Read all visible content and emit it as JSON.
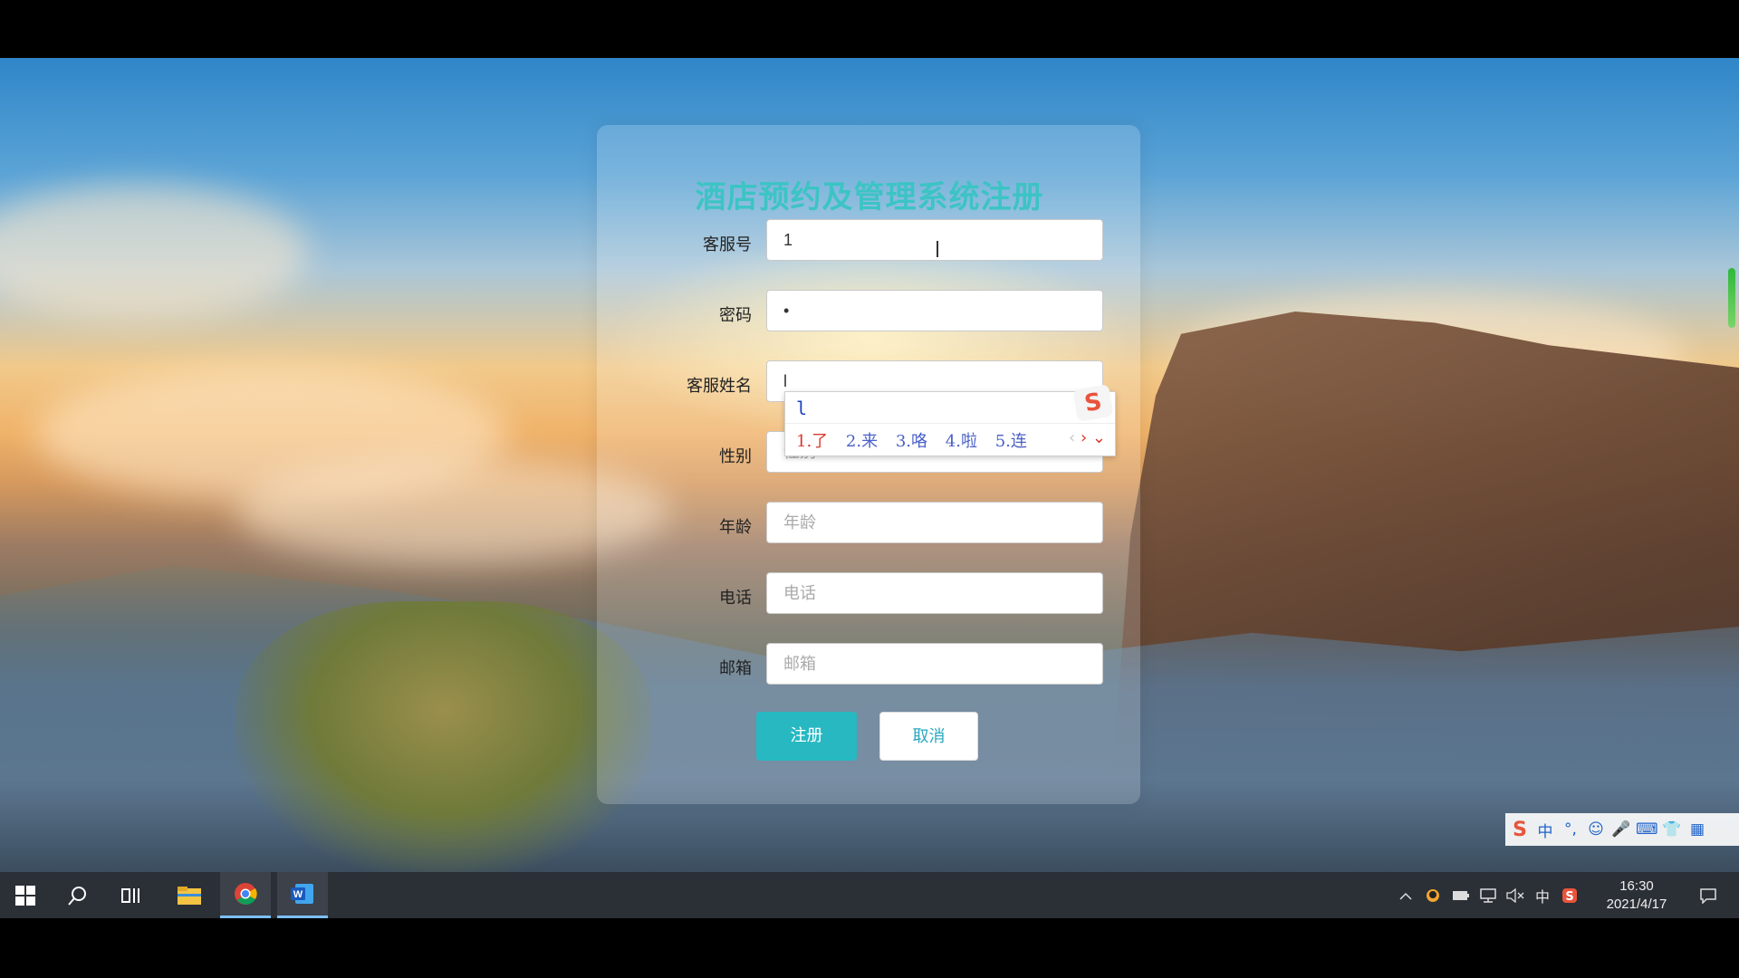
{
  "form": {
    "title": "酒店预约及管理系统注册",
    "fields": [
      {
        "label": "客服号",
        "value": "1",
        "placeholder": ""
      },
      {
        "label": "密码",
        "value": "•",
        "placeholder": ""
      },
      {
        "label": "客服姓名",
        "value": "l",
        "placeholder": ""
      },
      {
        "label": "性别",
        "value": "",
        "placeholder": "性别"
      },
      {
        "label": "年龄",
        "value": "",
        "placeholder": "年龄"
      },
      {
        "label": "电话",
        "value": "",
        "placeholder": "电话"
      },
      {
        "label": "邮箱",
        "value": "",
        "placeholder": "邮箱"
      }
    ],
    "register_label": "注册",
    "cancel_label": "取消"
  },
  "ime": {
    "composition": "l",
    "candidates": [
      "1.了",
      "2.来",
      "3.咯",
      "4.啦",
      "5.连"
    ],
    "nav_prev": "‹",
    "nav_next": "›",
    "nav_expand": "⌄",
    "logo": "S",
    "toolbar": [
      "S",
      "中",
      "°,",
      "☺",
      "🎤",
      "⌨",
      "👕",
      "▦"
    ]
  },
  "taskbar": {
    "clock_time": "16:30",
    "clock_date": "2021/4/17",
    "tray_ime": "中",
    "icons": [
      "windows-start",
      "search",
      "task-view",
      "file-explorer",
      "chrome",
      "word"
    ]
  },
  "colors": {
    "title": "#3cc4c4",
    "register_button": "#27b8c2",
    "cancel_text": "#2aa7c0",
    "taskbar": "#2b2f36"
  }
}
